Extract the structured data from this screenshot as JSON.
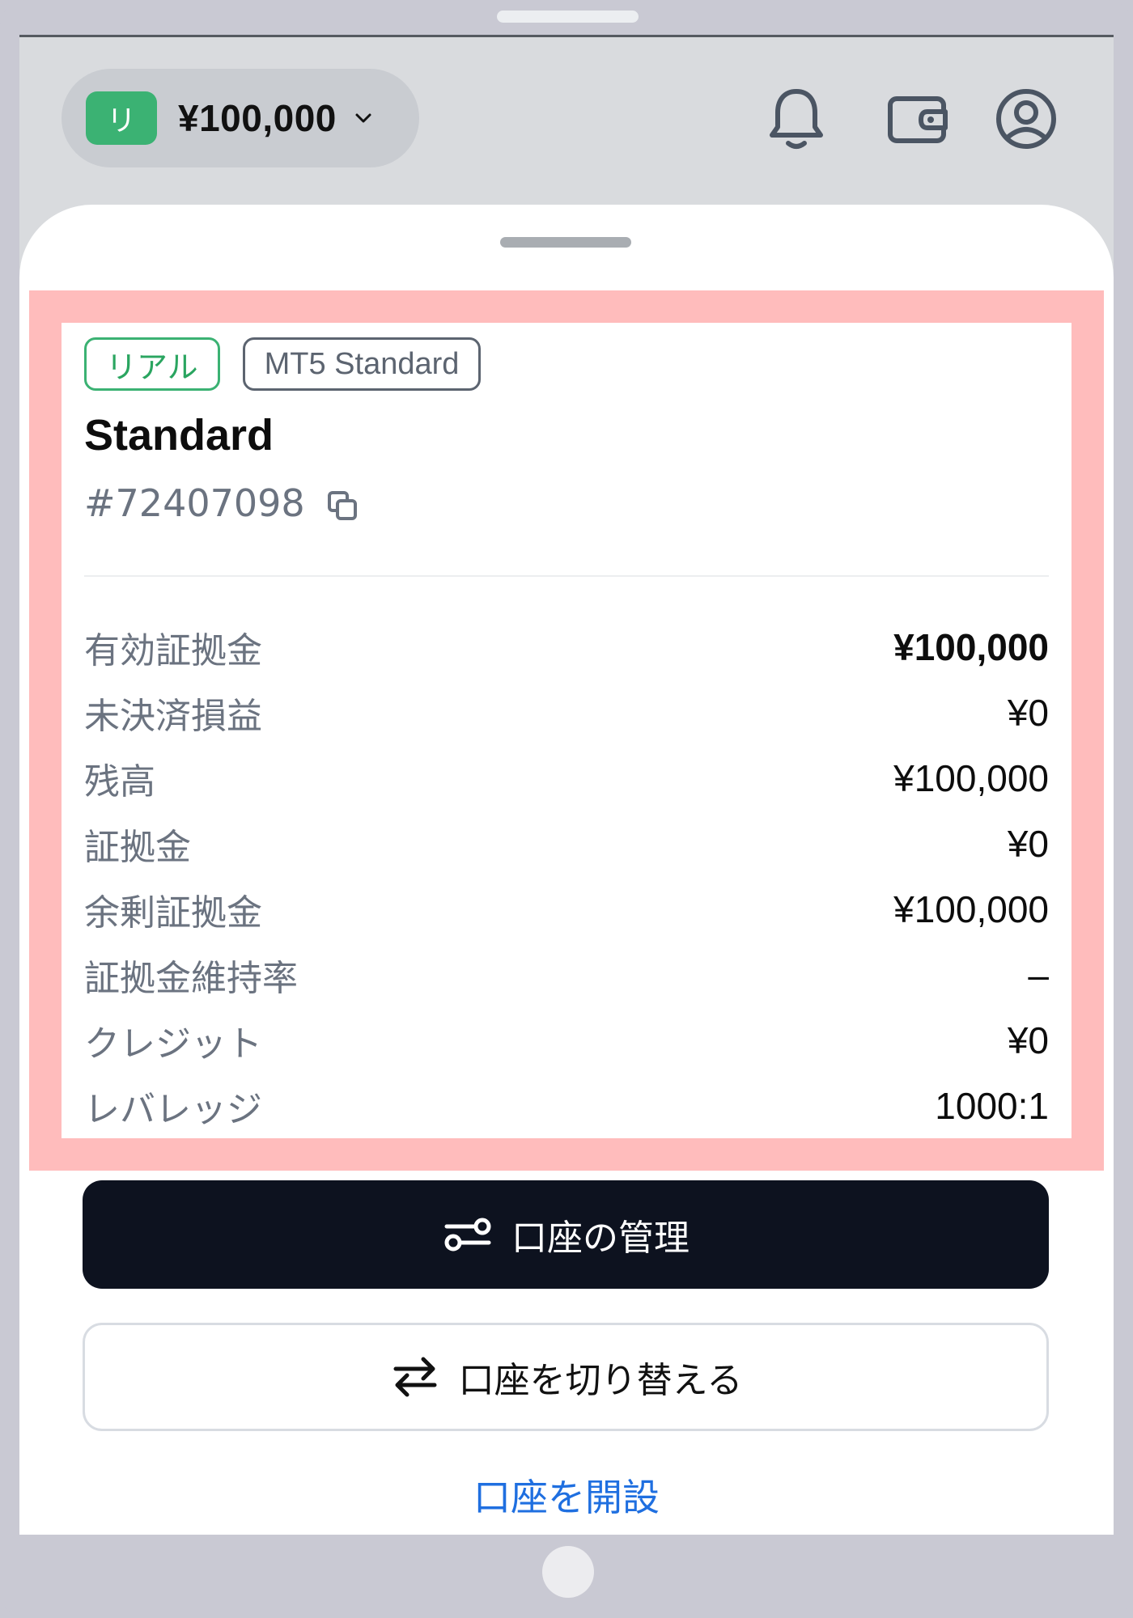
{
  "header": {
    "account_badge": "リ",
    "balance": "¥100,000",
    "icons": [
      "chevron-down-icon",
      "bell-icon",
      "wallet-icon",
      "user-circle-icon"
    ]
  },
  "account": {
    "tags": [
      "リアル",
      "MT5 Standard"
    ],
    "name": "Standard",
    "number": "#72407098",
    "details": [
      {
        "label": "有効証拠金",
        "value": "¥100,000",
        "bold": true
      },
      {
        "label": "未決済損益",
        "value": "¥0",
        "bold": false
      },
      {
        "label": "残高",
        "value": "¥100,000",
        "bold": false
      },
      {
        "label": "証拠金",
        "value": "¥0",
        "bold": false
      },
      {
        "label": "余剰証拠金",
        "value": "¥100,000",
        "bold": false
      },
      {
        "label": "証拠金維持率",
        "value": "–",
        "bold": false
      },
      {
        "label": "クレジット",
        "value": "¥0",
        "bold": false
      },
      {
        "label": "レバレッジ",
        "value": "1000:1",
        "bold": false
      }
    ]
  },
  "actions": {
    "manage_label": "口座の管理",
    "switch_label": "口座を切り替える",
    "open_label": "口座を開設"
  },
  "colors": {
    "accent_green": "#3bb273",
    "highlight": "#ffbcbc",
    "primary_button": "#0d121f",
    "link_blue": "#1f6fe0"
  }
}
